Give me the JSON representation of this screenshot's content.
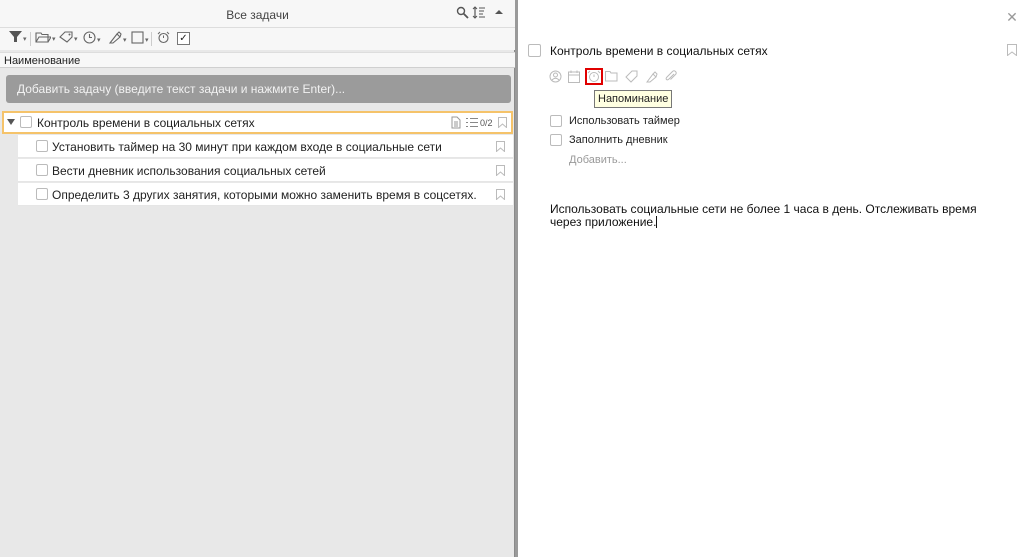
{
  "left_header": {
    "title": "Все задачи"
  },
  "column_header": {
    "name": "Наименование"
  },
  "add_task": {
    "placeholder": "Добавить задачу (введите текст задачи и нажмите Enter)..."
  },
  "tasks": {
    "parent": {
      "title": "Контроль времени в социальных сетях",
      "subtask_count": "0/2"
    },
    "children": [
      "Установить таймер на 30 минут при каждом входе в социальные сети",
      "Вести дневник использования социальных сетей",
      "Определить 3 других занятия, которыми можно заменить время в соцсетях."
    ]
  },
  "detail": {
    "title": "Контроль времени в социальных сетях",
    "tooltip": "Напоминание",
    "subtasks": [
      "Использовать таймер",
      "Заполнить дневник"
    ],
    "add_subtask": "Добавить...",
    "note": "Использовать социальные сети не более 1 часа в день. Отслеживать время через приложение."
  },
  "colors": {
    "accent_border": "#f5c36a",
    "highlight": "#e00000",
    "tooltip_bg": "#ffffe1"
  }
}
